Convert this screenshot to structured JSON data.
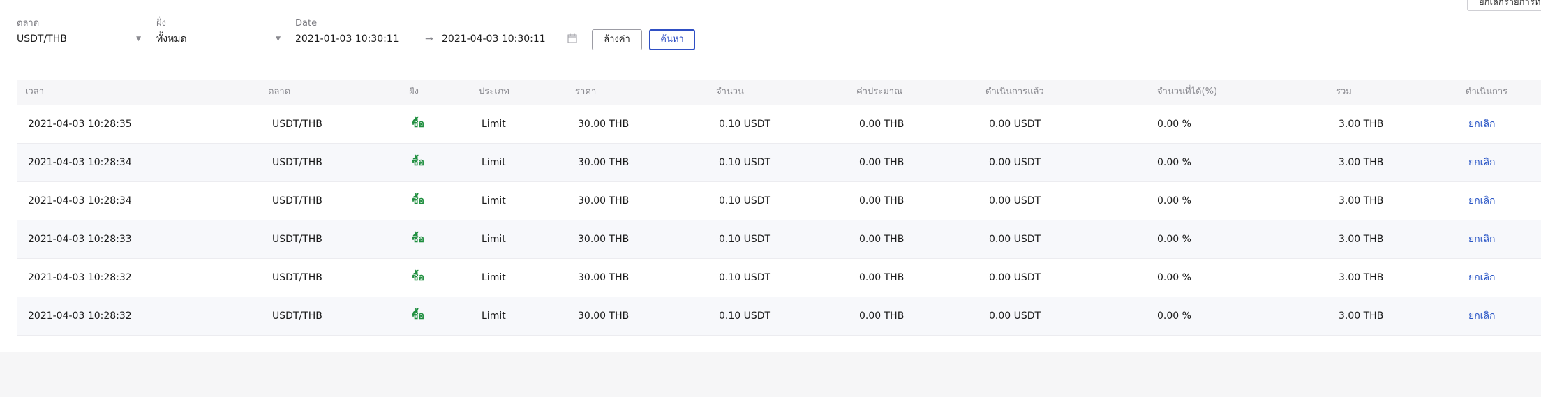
{
  "filters": {
    "market": {
      "label": "ตลาด",
      "value": "USDT/THB"
    },
    "side": {
      "label": "ฝั่ง",
      "value": "ทั้งหมด"
    },
    "date": {
      "label": "Date",
      "start": "2021-01-03 10:30:11",
      "end": "2021-04-03 10:30:11"
    },
    "clear_label": "ล้างค่า",
    "search_label": "ค้นหา"
  },
  "top_right_button": "ยกเลิกรายการทั้งหมด",
  "table": {
    "headers": [
      "เวลา",
      "ตลาด",
      "ฝั่ง",
      "ประเภท",
      "ราคา",
      "จำนวน",
      "ค่าประมาณ",
      "ดำเนินการแล้ว",
      "จำนวนที่ได้(%)",
      "รวม",
      "ดำเนินการ"
    ],
    "rows": [
      [
        "2021-04-03 10:28:35",
        "USDT/THB",
        "ซื้อ",
        "Limit",
        "30.00 THB",
        "0.10 USDT",
        "0.00 THB",
        "0.00 USDT",
        "0.00 %",
        "3.00 THB",
        "ยกเลิก"
      ],
      [
        "2021-04-03 10:28:34",
        "USDT/THB",
        "ซื้อ",
        "Limit",
        "30.00 THB",
        "0.10 USDT",
        "0.00 THB",
        "0.00 USDT",
        "0.00 %",
        "3.00 THB",
        "ยกเลิก"
      ],
      [
        "2021-04-03 10:28:34",
        "USDT/THB",
        "ซื้อ",
        "Limit",
        "30.00 THB",
        "0.10 USDT",
        "0.00 THB",
        "0.00 USDT",
        "0.00 %",
        "3.00 THB",
        "ยกเลิก"
      ],
      [
        "2021-04-03 10:28:33",
        "USDT/THB",
        "ซื้อ",
        "Limit",
        "30.00 THB",
        "0.10 USDT",
        "0.00 THB",
        "0.00 USDT",
        "0.00 %",
        "3.00 THB",
        "ยกเลิก"
      ],
      [
        "2021-04-03 10:28:32",
        "USDT/THB",
        "ซื้อ",
        "Limit",
        "30.00 THB",
        "0.10 USDT",
        "0.00 THB",
        "0.00 USDT",
        "0.00 %",
        "3.00 THB",
        "ยกเลิก"
      ],
      [
        "2021-04-03 10:28:32",
        "USDT/THB",
        "ซื้อ",
        "Limit",
        "30.00 THB",
        "0.10 USDT",
        "0.00 THB",
        "0.00 USDT",
        "0.00 %",
        "3.00 THB",
        "ยกเลิก"
      ]
    ]
  },
  "colors": {
    "buy": "#1e8e3e",
    "link": "#2a56c6",
    "primary_button": "#2f4fc4"
  },
  "icons": {
    "date_separator": "arrow-right-icon",
    "calendar": "calendar-icon",
    "dropdown": "chevron-down-icon"
  }
}
